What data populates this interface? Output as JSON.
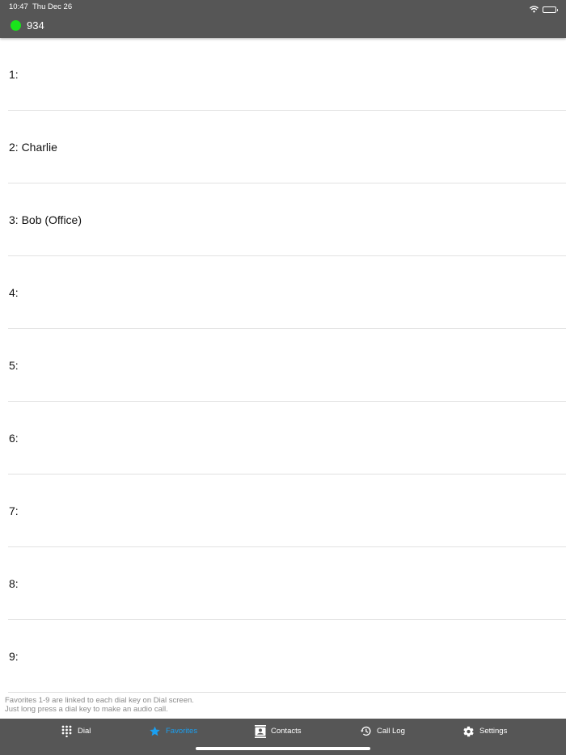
{
  "status_bar": {
    "time": "10:47",
    "date": "Thu Dec 26"
  },
  "header": {
    "presence_color": "#19e51b",
    "account_number": "934"
  },
  "favorites": [
    {
      "label": "1:"
    },
    {
      "label": "2: Charlie"
    },
    {
      "label": "3: Bob (Office)"
    },
    {
      "label": "4:"
    },
    {
      "label": "5:"
    },
    {
      "label": "6:"
    },
    {
      "label": "7:"
    },
    {
      "label": "8:"
    },
    {
      "label": "9:"
    }
  ],
  "footnote": {
    "line1": "Favorites 1-9 are linked to each dial key on Dial screen.",
    "line2": "Just long press a dial key to make an audio call."
  },
  "tabs": {
    "dial": {
      "label": "Dial",
      "icon": "dialpad-icon"
    },
    "favorites": {
      "label": "Favorites",
      "icon": "star-icon",
      "active": true
    },
    "contacts": {
      "label": "Contacts",
      "icon": "contact-card-icon"
    },
    "call_log": {
      "label": "Call Log",
      "icon": "history-icon"
    },
    "settings": {
      "label": "Settings",
      "icon": "gear-icon"
    }
  },
  "colors": {
    "bar_background": "#565656",
    "active_tab": "#1a9ff0",
    "online": "#19e51b"
  }
}
